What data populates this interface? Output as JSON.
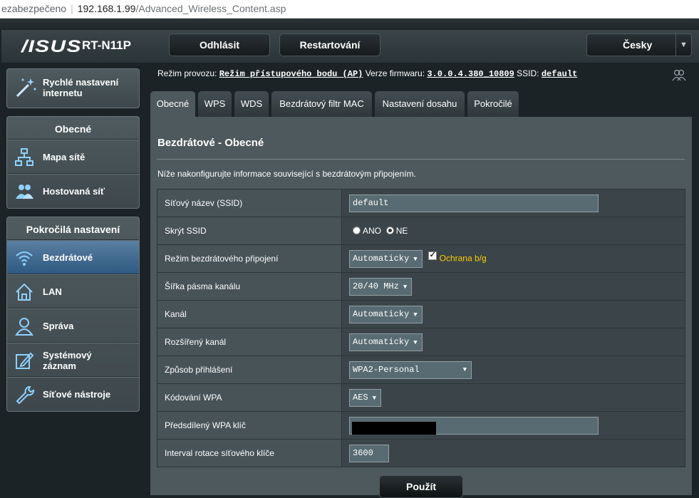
{
  "browser": {
    "security_label": "ezabezpečeno",
    "host": "192.168.1.99",
    "path": "/Advanced_Wireless_Content.asp"
  },
  "header": {
    "brand": "/ISUS",
    "model": "RT-N11P",
    "logout": "Odhlásit",
    "restart": "Restartování",
    "language": "Česky"
  },
  "sidebar": {
    "quick_setup": "Rychlé nastavení internetu",
    "general_head": "Obecné",
    "general_items": [
      {
        "label": "Mapa sítě",
        "icon": "network-map-icon"
      },
      {
        "label": "Hostovaná síť",
        "icon": "guest-network-icon"
      }
    ],
    "advanced_head": "Pokročilá nastavení",
    "advanced_items": [
      {
        "label": "Bezdrátové",
        "icon": "wifi-icon"
      },
      {
        "label": "LAN",
        "icon": "home-icon"
      },
      {
        "label": "Správa",
        "icon": "user-icon"
      },
      {
        "label": "Systémový záznam",
        "icon": "edit-log-icon"
      },
      {
        "label": "Síťové nástroje",
        "icon": "wrench-icon"
      }
    ]
  },
  "info": {
    "mode_label": "Režim provozu:",
    "mode_value": "Režim přístupového bodu (AP)",
    "fw_label": "Verze firmwaru:",
    "fw_value": "3.0.0.4.380_10809",
    "ssid_label": "SSID:",
    "ssid_value": "default"
  },
  "tabs": [
    "Obecné",
    "WPS",
    "WDS",
    "Bezdrátový filtr MAC",
    "Nastavení dosahu",
    "Pokročilé"
  ],
  "main": {
    "title": "Bezdrátové - Obecné",
    "description": "Níže nakonfigurujte informace související s bezdrátovým připojením.",
    "rows": {
      "ssid_label": "Síťový název (SSID)",
      "ssid_value": "default",
      "hide_label": "Skrýt SSID",
      "hide_yes": "ANO",
      "hide_no": "NE",
      "mode_label": "Režim bezdrátového připojení",
      "mode_value": "Automaticky",
      "bg_protect": "Ochrana b/g",
      "bw_label": "Šířka pásma kanálu",
      "bw_value": "20/40 MHz",
      "channel_label": "Kanál",
      "channel_value": "Automaticky",
      "ext_label": "Rozšířený kanál",
      "ext_value": "Automaticky",
      "auth_label": "Způsob přihlášení",
      "auth_value": "WPA2-Personal",
      "enc_label": "Kódování WPA",
      "enc_value": "AES",
      "psk_label": "Předsdílený WPA klíč",
      "interval_label": "Interval rotace síťového klíče",
      "interval_value": "3600"
    },
    "apply": "Použít"
  }
}
